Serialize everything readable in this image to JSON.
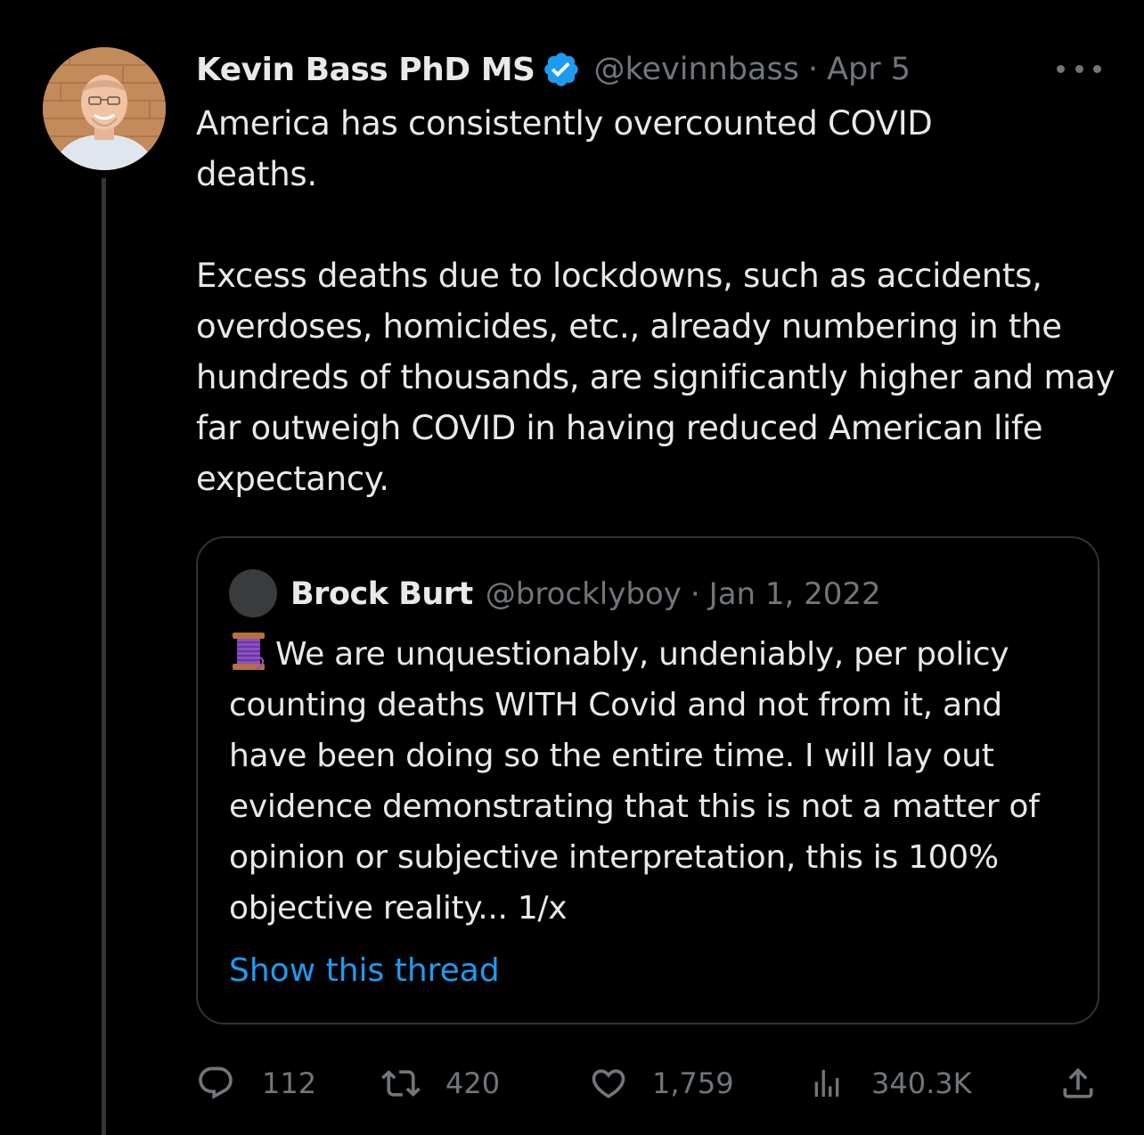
{
  "tweet": {
    "author_name": "Kevin Bass PhD MS",
    "handle": "@kevinnbass",
    "separator": "·",
    "date": "Apr 5",
    "text": "America has consistently overcounted COVID\ndeaths.\n\nExcess deaths due to lockdowns, such as accidents, overdoses, homicides, etc., already numbering in the hundreds of thousands, are significantly higher and may far outweigh COVID in having reduced American life expectancy."
  },
  "quote": {
    "author_name": "Brock Burt",
    "handle": "@brocklyboy",
    "separator": "·",
    "date": "Jan 1, 2022",
    "text": "We are unquestionably, undeniably, per policy counting deaths WITH Covid and not from it, and have been doing so the entire time. I will lay out evidence demonstrating that this is not a matter of opinion or subjective interpretation, this is 100% objective reality...  1/x",
    "show_thread": "Show this thread"
  },
  "actions": {
    "replies": "112",
    "retweets": "420",
    "likes": "1,759",
    "views": "340.3K"
  },
  "icons": {
    "verified": "verified-badge-icon",
    "more": "more-options-icon",
    "reply": "reply-icon",
    "retweet": "retweet-icon",
    "like": "heart-icon",
    "views": "views-chart-icon",
    "share": "share-icon",
    "spool": "thread-spool-emoji"
  },
  "colors": {
    "background": "#000000",
    "text": "#e7e9ea",
    "secondary": "#71767b",
    "accent": "#1d9bf0",
    "border": "#2f3336"
  }
}
